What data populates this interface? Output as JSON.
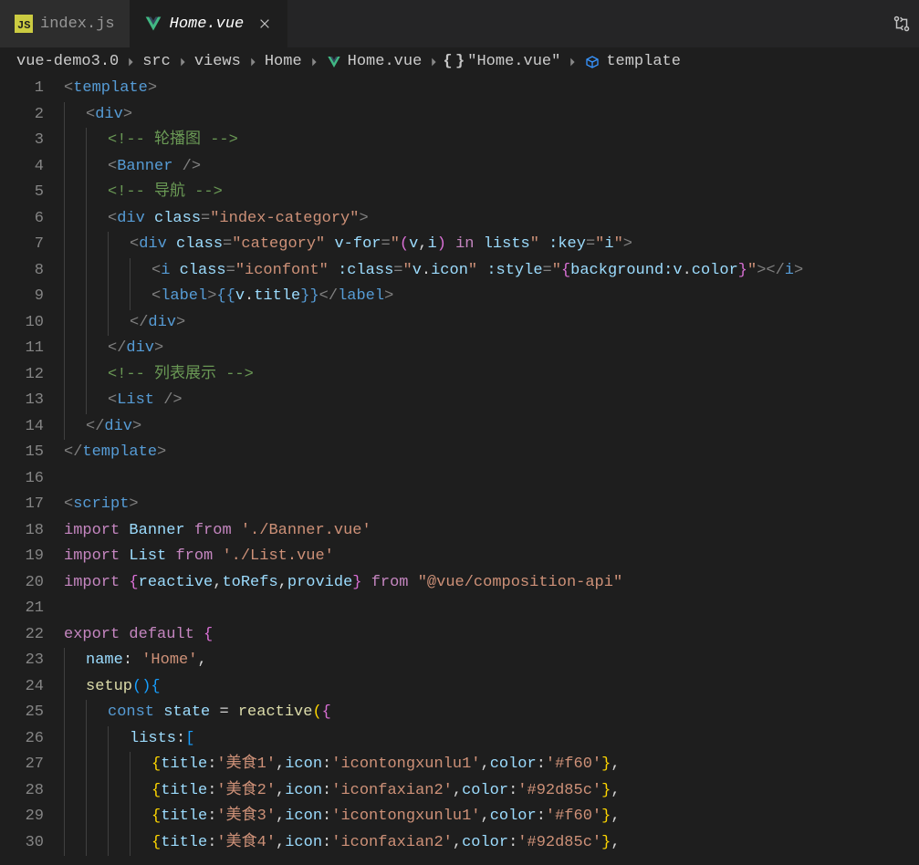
{
  "tabs": [
    {
      "label": "index.js",
      "icon": "js",
      "active": false
    },
    {
      "label": "Home.vue",
      "icon": "vue",
      "active": true
    }
  ],
  "breadcrumbs": [
    {
      "label": "vue-demo3.0",
      "icon": null
    },
    {
      "label": "src",
      "icon": null
    },
    {
      "label": "views",
      "icon": null
    },
    {
      "label": "Home",
      "icon": null
    },
    {
      "label": "Home.vue",
      "icon": "vue"
    },
    {
      "label": "\"Home.vue\"",
      "icon": "braces"
    },
    {
      "label": "template",
      "icon": "cube"
    }
  ],
  "code_lines": [
    {
      "n": 1,
      "indent": 0,
      "html": "<span class='p'>&lt;</span><span class='tag'>template</span><span class='p'>&gt;</span>"
    },
    {
      "n": 2,
      "indent": 1,
      "html": "<span class='p'>&lt;</span><span class='tag'>div</span><span class='p'>&gt;</span>"
    },
    {
      "n": 3,
      "indent": 2,
      "html": "<span class='cmt'>&lt;!-- 轮播图 --&gt;</span>"
    },
    {
      "n": 4,
      "indent": 2,
      "html": "<span class='p'>&lt;</span><span class='tag'>Banner</span> <span class='p'>/&gt;</span>"
    },
    {
      "n": 5,
      "indent": 2,
      "html": "<span class='cmt'>&lt;!-- 导航 --&gt;</span>"
    },
    {
      "n": 6,
      "indent": 2,
      "html": "<span class='p'>&lt;</span><span class='tag'>div</span> <span class='attr'>class</span><span class='p'>=</span><span class='str'>\"index-category\"</span><span class='p'>&gt;</span>"
    },
    {
      "n": 7,
      "indent": 3,
      "html": "<span class='p'>&lt;</span><span class='tag'>div</span> <span class='attr'>class</span><span class='p'>=</span><span class='str'>\"category\"</span> <span class='attr'>v-for</span><span class='p'>=</span><span class='str'>\"</span><span class='br'>(</span><span class='attr'>v</span><span class='white'>,</span><span class='attr'>i</span><span class='br'>)</span> <span class='kw'>in</span> <span class='attr'>lists</span><span class='str'>\"</span> <span class='attr'>:key</span><span class='p'>=</span><span class='str'>\"</span><span class='attr'>i</span><span class='str'>\"</span><span class='p'>&gt;</span>"
    },
    {
      "n": 8,
      "indent": 4,
      "html": "<span class='p'>&lt;</span><span class='tag'>i</span> <span class='attr'>class</span><span class='p'>=</span><span class='str'>\"iconfont\"</span> <span class='attr'>:class</span><span class='p'>=</span><span class='str'>\"</span><span class='attr'>v</span><span class='white'>.</span><span class='attr'>icon</span><span class='str'>\"</span> <span class='attr'>:style</span><span class='p'>=</span><span class='str'>\"</span><span class='br'>{</span><span class='attr'>background:v</span><span class='white'>.</span><span class='attr'>color</span><span class='br'>}</span><span class='str'>\"</span><span class='p'>&gt;&lt;/</span><span class='tag'>i</span><span class='p'>&gt;</span>"
    },
    {
      "n": 9,
      "indent": 4,
      "html": "<span class='p'>&lt;</span><span class='tag'>label</span><span class='p'>&gt;</span><span class='mustache'>{{</span><span class='attr'>v</span><span class='white'>.</span><span class='attr'>title</span><span class='mustache'>}}</span><span class='p'>&lt;/</span><span class='tag'>label</span><span class='p'>&gt;</span>"
    },
    {
      "n": 10,
      "indent": 3,
      "html": "<span class='p'>&lt;/</span><span class='tag'>div</span><span class='p'>&gt;</span>"
    },
    {
      "n": 11,
      "indent": 2,
      "html": "<span class='p'>&lt;/</span><span class='tag'>div</span><span class='p'>&gt;</span>"
    },
    {
      "n": 12,
      "indent": 2,
      "html": "<span class='cmt'>&lt;!-- 列表展示 --&gt;</span>"
    },
    {
      "n": 13,
      "indent": 2,
      "html": "<span class='p'>&lt;</span><span class='tag'>List</span> <span class='p'>/&gt;</span>"
    },
    {
      "n": 14,
      "indent": 1,
      "html": "<span class='p'>&lt;/</span><span class='tag'>div</span><span class='p'>&gt;</span>"
    },
    {
      "n": 15,
      "indent": 0,
      "html": "<span class='p'>&lt;/</span><span class='tag'>template</span><span class='p'>&gt;</span>"
    },
    {
      "n": 16,
      "indent": 0,
      "html": ""
    },
    {
      "n": 17,
      "indent": 0,
      "html": "<span class='p'>&lt;</span><span class='tag'>script</span><span class='p'>&gt;</span>"
    },
    {
      "n": 18,
      "indent": 0,
      "html": "<span class='kw'>import</span> <span class='attr'>Banner</span> <span class='kw'>from</span> <span class='str'>'./Banner.vue'</span>"
    },
    {
      "n": 19,
      "indent": 0,
      "html": "<span class='kw'>import</span> <span class='attr'>List</span> <span class='kw'>from</span> <span class='str'>'./List.vue'</span>"
    },
    {
      "n": 20,
      "indent": 0,
      "html": "<span class='kw'>import</span> <span class='br'>{</span><span class='attr'>reactive</span><span class='white'>,</span><span class='attr'>toRefs</span><span class='white'>,</span><span class='attr'>provide</span><span class='br'>}</span> <span class='kw'>from</span> <span class='str'>\"@vue/composition-api\"</span>"
    },
    {
      "n": 21,
      "indent": 0,
      "html": ""
    },
    {
      "n": 22,
      "indent": 0,
      "html": "<span class='kw'>export</span> <span class='kw'>default</span> <span class='br'>{</span>"
    },
    {
      "n": 23,
      "indent": 1,
      "html": "<span class='attr'>name</span><span class='white'>:</span> <span class='str'>'Home'</span><span class='white'>,</span>"
    },
    {
      "n": 24,
      "indent": 1,
      "html": "<span class='fn'>setup</span><span class='br2'>(</span><span class='br2'>)</span><span class='br2'>{</span>"
    },
    {
      "n": 25,
      "indent": 2,
      "html": "<span class='kw2'>const</span> <span class='attr'>state</span> <span class='white'>=</span> <span class='fn'>reactive</span><span class='br3'>(</span><span class='br'>{</span>"
    },
    {
      "n": 26,
      "indent": 3,
      "html": "<span class='attr'>lists</span><span class='white'>:</span><span class='br2'>[</span>"
    },
    {
      "n": 27,
      "indent": 4,
      "html": "<span class='br3'>{</span><span class='attr'>title</span><span class='white'>:</span><span class='str'>'美食1'</span><span class='white'>,</span><span class='attr'>icon</span><span class='white'>:</span><span class='str'>'icontongxunlu1'</span><span class='white'>,</span><span class='attr'>color</span><span class='white'>:</span><span class='str'>'#f60'</span><span class='br3'>}</span><span class='white'>,</span>"
    },
    {
      "n": 28,
      "indent": 4,
      "html": "<span class='br3'>{</span><span class='attr'>title</span><span class='white'>:</span><span class='str'>'美食2'</span><span class='white'>,</span><span class='attr'>icon</span><span class='white'>:</span><span class='str'>'iconfaxian2'</span><span class='white'>,</span><span class='attr'>color</span><span class='white'>:</span><span class='str'>'#92d85c'</span><span class='br3'>}</span><span class='white'>,</span>"
    },
    {
      "n": 29,
      "indent": 4,
      "html": "<span class='br3'>{</span><span class='attr'>title</span><span class='white'>:</span><span class='str'>'美食3'</span><span class='white'>,</span><span class='attr'>icon</span><span class='white'>:</span><span class='str'>'icontongxunlu1'</span><span class='white'>,</span><span class='attr'>color</span><span class='white'>:</span><span class='str'>'#f60'</span><span class='br3'>}</span><span class='white'>,</span>"
    },
    {
      "n": 30,
      "indent": 4,
      "html": "<span class='br3'>{</span><span class='attr'>title</span><span class='white'>:</span><span class='str'>'美食4'</span><span class='white'>,</span><span class='attr'>icon</span><span class='white'>:</span><span class='str'>'iconfaxian2'</span><span class='white'>,</span><span class='attr'>color</span><span class='white'>:</span><span class='str'>'#92d85c'</span><span class='br3'>}</span><span class='white'>,</span>"
    }
  ]
}
